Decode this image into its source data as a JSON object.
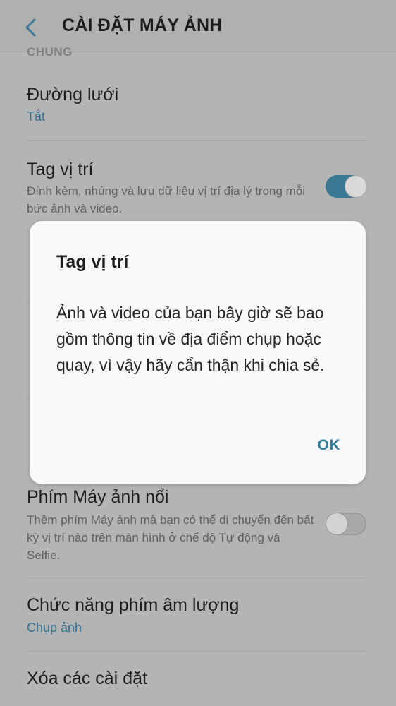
{
  "header": {
    "title": "CÀI ĐẶT MÁY ẢNH",
    "back_icon": "chevron-left-icon"
  },
  "section": {
    "label": "CHUNG"
  },
  "settings": {
    "grid": {
      "title": "Đường lưới",
      "value": "Tắt"
    },
    "location_tag": {
      "title": "Tag vị trí",
      "description": "Đính kèm, nhúng và lưu dữ liệu vị trí địa lý trong mỗi bức ảnh và video.",
      "enabled": true
    },
    "floating_button": {
      "title": "Phím Máy ảnh nổi",
      "description": "Thêm phím Máy ảnh mà bạn có thể di chuyển đến bất kỳ vị trí nào trên màn hình ở chế độ Tự động và Selfie.",
      "enabled": false
    },
    "volume_key": {
      "title": "Chức năng phím âm lượng",
      "value": "Chụp ảnh"
    },
    "reset": {
      "title": "Xóa các cài đặt"
    }
  },
  "dialog": {
    "title": "Tag vị trí",
    "body": "Ảnh và video của bạn bây giờ sẽ bao gồm thông tin về địa điểm chụp hoặc quay, vì vậy hãy cẩn thận khi chia sẻ.",
    "ok_label": "OK"
  },
  "colors": {
    "accent": "#2e7c9c",
    "toggle_on": "#3b7893"
  }
}
